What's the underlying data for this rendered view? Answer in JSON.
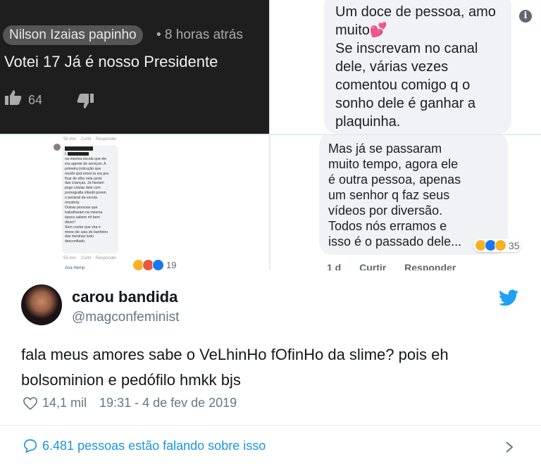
{
  "youtube_comment": {
    "user": "Nilson Izaias papinho",
    "time": "• 8 horas atrás",
    "text": "Votei 17  Já é nosso Presidente",
    "likes": "64"
  },
  "comment_top_right": {
    "text": "Um doce de pessoa, amo\nmuito💕\nSe inscrevam no canal\ndele, várias vezes\ncomentou comigo q o\nsonho dele é ganhar a\nplaquinha."
  },
  "facebook_comment_small": {
    "time": "56 min",
    "reply_like": "Curtir",
    "reply_reply": "Responder",
    "text": "L          trabalhei\nna mesma escola que ele\nera agente de serviços. A\nprimeira instrução que\nrecebi qnd entrei la era pra\nficar de olho nele perto\ndas crianças. Ja haviam\npego celular dele com\npornografia infantil porem\no pessoal da escola\nencobria.\nOutras pessoas que\ntrabalharam na mesma\népoca sabem mt bem\ndisso!!\nSem contar que vira e\nmexe ele saía do banheiro\ndas meninas todo\ndesconfiado.",
    "time2": "55 min",
    "next_user": "Ana Hemp",
    "reactions": "19"
  },
  "comment_bottom_right": {
    "text": "Mas já se passaram\nmuito tempo, agora ele\né outra pessoa, apenas\num senhor q faz seus\nvídeos por diversão.\nTodos nós erramos e\nisso é o passado dele...",
    "reactions": "35",
    "time": "1 d",
    "like": "Curtir",
    "reply": "Responder"
  },
  "tweet": {
    "name": "carou bandida",
    "handle": "@magconfeminist",
    "text": "fala meus amores sabe o VeLhinHo fOfinHo da slime? pois eh\nbolsominion e pedófilo hmkk bjs",
    "likes": "14,1 mil",
    "timestamp": "19:31 - 4 de fev de 2019",
    "conversation": "6.481 pessoas estão falando sobre isso"
  },
  "colors": {
    "twitter_blue": "#1da1f2",
    "link_blue": "#1b95e0"
  },
  "icons": [
    "thumbs-up-icon",
    "thumbs-down-icon",
    "info-icon",
    "twitter-bird-icon",
    "heart-icon",
    "speech-bubble-icon",
    "chevron-right-icon"
  ]
}
